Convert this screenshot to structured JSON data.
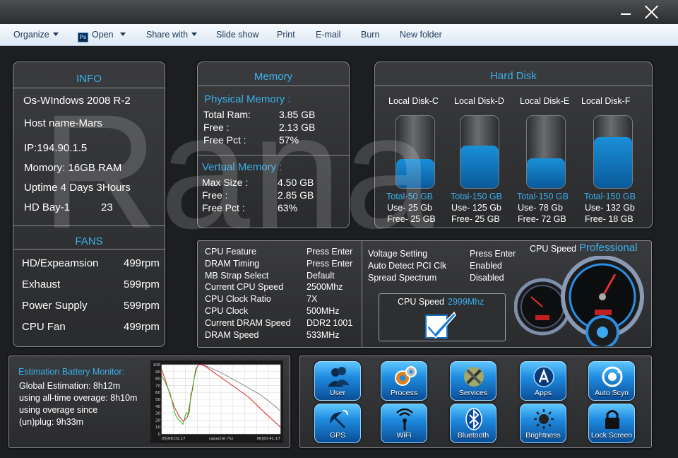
{
  "window": {
    "minimize_icon": "minimize-icon",
    "close_icon": "close-icon"
  },
  "toolbar": {
    "organize": "Organize",
    "open": "Open",
    "open_icon_text": "Ps",
    "share_with": "Share with",
    "slide_show": "Slide show",
    "print": "Print",
    "email": "E-mail",
    "burn": "Burn",
    "new_folder": "New folder"
  },
  "watermark": "Rana",
  "info": {
    "title": "INFO",
    "os": "Os-WIndows 2008 R-2",
    "host": "Host name-Mars",
    "ip": "IP:194.90.1.5",
    "memory": "Momory: 16GB RAM",
    "uptime": "Uptime 4 Days 3Hours",
    "hd_bay_label": "HD Bay-1",
    "hd_bay_value": "23"
  },
  "fans": {
    "title": "FANS",
    "items": [
      {
        "label": "HD/Expeamsion",
        "value": "499rpm"
      },
      {
        "label": "Exhaust",
        "value": "599rpm"
      },
      {
        "label": "Power Supply",
        "value": "599rpm"
      },
      {
        "label": "CPU Fan",
        "value": "499rpm"
      }
    ]
  },
  "memory": {
    "title": "Memory",
    "physical_title": "Physical Memory :",
    "physical": [
      {
        "label": "Total Ram:",
        "value": "3.85 GB"
      },
      {
        "label": "Free :",
        "value": "2.13 GB"
      },
      {
        "label": "Free Pct :",
        "value": "57%"
      }
    ],
    "virtual_title": "Vertual Memory :",
    "virtual": [
      {
        "label": "Max Size :",
        "value": "4.50 GB"
      },
      {
        "label": "Free :",
        "value": "2.85 GB"
      },
      {
        "label": "Free Pct :",
        "value": "63%"
      }
    ]
  },
  "hard_disk": {
    "title": "Hard Disk",
    "disks": [
      {
        "name": "Local Disk-C",
        "total": "Total-50 GB",
        "use": "Use- 25 Gb",
        "free": "Free- 25 GB",
        "used_fraction": 0.5
      },
      {
        "name": "Local Disk-D",
        "total": "Total-150 GB",
        "use": "Use- 125 Gb",
        "free": "Free- 25 GB",
        "used_fraction": 0.73
      },
      {
        "name": "Local Disk-E",
        "total": "Total-150 GB",
        "use": "Use- 78 Gb",
        "free": "Free- 72 GB",
        "used_fraction": 0.52
      },
      {
        "name": "Local Disk-F",
        "total": "Total-150 GB",
        "use": "Use- 132 Gb",
        "free": "Free- 18 GB",
        "used_fraction": 0.88
      }
    ]
  },
  "bios": {
    "left": [
      {
        "label": "CPU Feature",
        "value": "Press Enter"
      },
      {
        "label": "DRAM Timing",
        "value": "Press Enter"
      },
      {
        "label": "MB Strap Select",
        "value": "Default"
      },
      {
        "label": "Current CPU Speed",
        "value": "2500Mhz"
      },
      {
        "label": "CPU Clock Ratio",
        "value": "7X"
      },
      {
        "label": "CPU Clock",
        "value": "500MHz"
      },
      {
        "label": "Current DRAM Speed",
        "value": "DDR2 1001"
      },
      {
        "label": "DRAM Speed",
        "value": "533MHz"
      }
    ],
    "right": [
      {
        "label": "Voltage Setting",
        "value": "Press Enter"
      },
      {
        "label": "Auto Detect PCI Clk",
        "value": "Enabled"
      },
      {
        "label": "Spread Spectrum",
        "value": "Disabled"
      }
    ],
    "cpu_speed_label": "CPU Speed",
    "cpu_speed_value": "2999Mhz",
    "checkmark_icon": "checkmark-icon"
  },
  "gauge": {
    "label": "CPU Speed",
    "edition": "Professional",
    "icon": "speedometer-gauge-icon"
  },
  "battery": {
    "title": "Estimation Battery Monitor:",
    "lines": [
      "Global Estimation:  8h12m",
      "using all-time overage: 8h10m",
      "using overage since",
      "(un)plug: 9h33m"
    ],
    "chart_data": {
      "type": "line",
      "x_labels": [
        "05|08:01:17",
        "capacité (%)",
        "06|00:41:17"
      ],
      "y_ticks": [
        "100",
        "90",
        "80",
        "70",
        "60",
        "50",
        "40",
        "30",
        "20",
        "10",
        "0"
      ],
      "ylim": [
        0,
        100
      ],
      "grid": true,
      "colors": {
        "measured": "#2fbf2f",
        "estimate": "#e02020",
        "history": "#ffffff"
      },
      "series": [
        {
          "values": [
            [
              0,
              85
            ],
            [
              2,
              72
            ],
            [
              4,
              58
            ],
            [
              5,
              44
            ],
            [
              6,
              30
            ],
            [
              7,
              24
            ],
            [
              8,
              20
            ],
            [
              9,
              17
            ],
            [
              9.8,
              14
            ],
            [
              10.3,
              19
            ],
            [
              11,
              28
            ],
            [
              11.6,
              31
            ],
            [
              12.3,
              27
            ],
            [
              12.9,
              33
            ],
            [
              13.5,
              58
            ],
            [
              14.3,
              63
            ],
            [
              15,
              80
            ],
            [
              15.6,
              92
            ],
            [
              16.3,
              97
            ]
          ]
        },
        {
          "values": [
            [
              0,
              93
            ],
            [
              2,
              75
            ],
            [
              4,
              55
            ],
            [
              6,
              38
            ],
            [
              8,
              26
            ],
            [
              10,
              18
            ],
            [
              12,
              25
            ],
            [
              13.4,
              50
            ],
            [
              15,
              80
            ],
            [
              16.2,
              95
            ],
            [
              17,
              100
            ],
            [
              18.5,
              100
            ],
            [
              20,
              98
            ],
            [
              30,
              76
            ],
            [
              40,
              54
            ],
            [
              48,
              30
            ],
            [
              55,
              10
            ]
          ]
        },
        {
          "values": [
            [
              19,
              100
            ],
            [
              26,
              91
            ],
            [
              36,
              74
            ],
            [
              46,
              56
            ],
            [
              53,
              39
            ],
            [
              55,
              33
            ]
          ]
        }
      ]
    }
  },
  "apps": [
    {
      "label": "User",
      "icon": "users-icon"
    },
    {
      "label": "Process",
      "icon": "gears-icon"
    },
    {
      "label": "Services",
      "icon": "tools-icon"
    },
    {
      "label": "Apps",
      "icon": "app-store-icon"
    },
    {
      "label": "Auto Scyn",
      "icon": "sync-icon"
    },
    {
      "label": "GPS",
      "icon": "satellite-dish-icon"
    },
    {
      "label": "WiFi",
      "icon": "wifi-icon"
    },
    {
      "label": "Bluetooth",
      "icon": "bluetooth-icon"
    },
    {
      "label": "Brightness",
      "icon": "brightness-icon"
    },
    {
      "label": "Lock Screen",
      "icon": "padlock-icon"
    }
  ]
}
